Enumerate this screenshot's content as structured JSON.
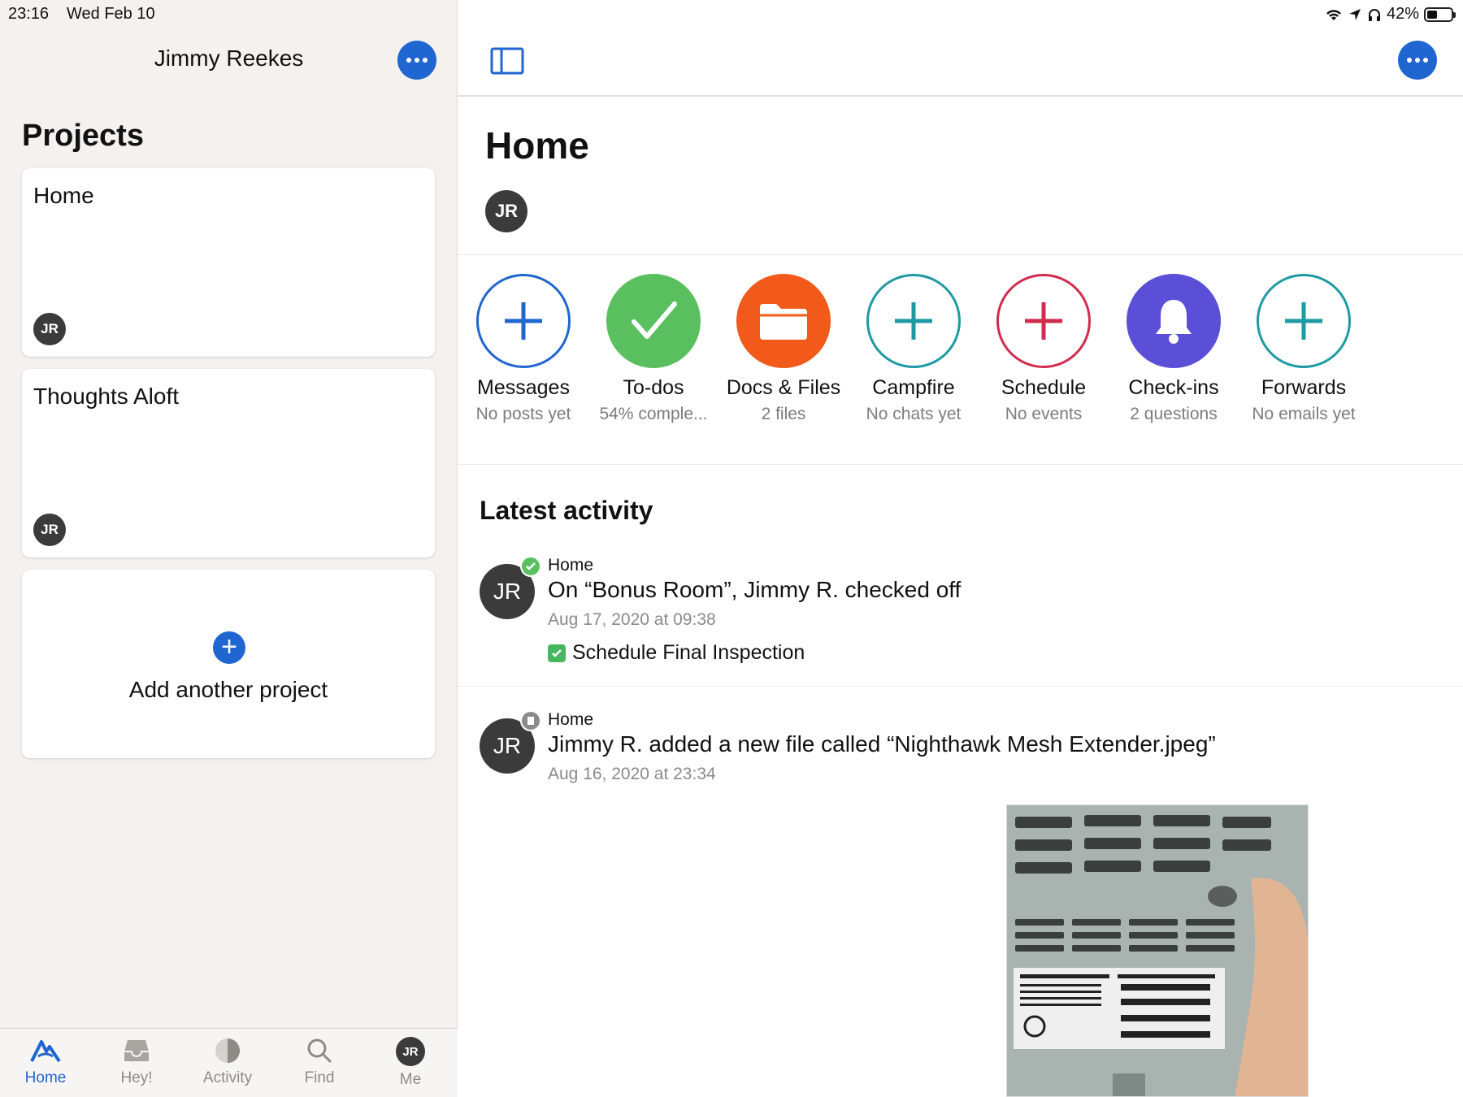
{
  "status": {
    "time": "23:16",
    "date": "Wed Feb 10",
    "battery": "42%",
    "battery_level": 0.42
  },
  "sidebar": {
    "user_name": "Jimmy Reekes",
    "projects_title": "Projects",
    "projects": [
      {
        "name": "Home",
        "avatar": "JR"
      },
      {
        "name": "Thoughts Aloft",
        "avatar": "JR"
      }
    ],
    "add_project_label": "Add another project"
  },
  "tabs": [
    {
      "label": "Home",
      "icon": "home-mountain-icon",
      "active": true
    },
    {
      "label": "Hey!",
      "icon": "inbox-icon"
    },
    {
      "label": "Activity",
      "icon": "activity-pie-icon"
    },
    {
      "label": "Find",
      "icon": "search-icon"
    },
    {
      "label": "Me",
      "avatar": "JR"
    }
  ],
  "main": {
    "project_title": "Home",
    "project_avatar": "JR",
    "tools": [
      {
        "name": "Messages",
        "sub": "No posts yet",
        "color": "#1f66d1",
        "icon": "plus-icon"
      },
      {
        "name": "To-dos",
        "sub": "54% comple...",
        "color": "#5ac05f",
        "icon": "check-icon"
      },
      {
        "name": "Docs & Files",
        "sub": "2 files",
        "color": "#f15a1b",
        "icon": "folder-icon"
      },
      {
        "name": "Campfire",
        "sub": "No chats yet",
        "color": "#1e9aa3",
        "icon": "plus-icon"
      },
      {
        "name": "Schedule",
        "sub": "No events",
        "color": "#d12b4e",
        "icon": "plus-icon"
      },
      {
        "name": "Check-ins",
        "sub": "2 questions",
        "color": "#5a4fd6",
        "icon": "bell-icon"
      },
      {
        "name": "Forwards",
        "sub": "No emails yet",
        "color": "#1e9aa3",
        "icon": "plus-icon"
      }
    ],
    "latest_activity_title": "Latest activity",
    "activity": [
      {
        "project": "Home",
        "avatar": "JR",
        "headline": "On “Bonus Room”, Jimmy R. checked off",
        "when": "Aug 17, 2020 at 09:38",
        "todo": "Schedule Final Inspection"
      },
      {
        "project": "Home",
        "avatar": "JR",
        "headline": "Jimmy R. added a new file called “Nighthawk Mesh Extender.jpeg”",
        "when": "Aug 16, 2020 at 23:34"
      }
    ]
  }
}
